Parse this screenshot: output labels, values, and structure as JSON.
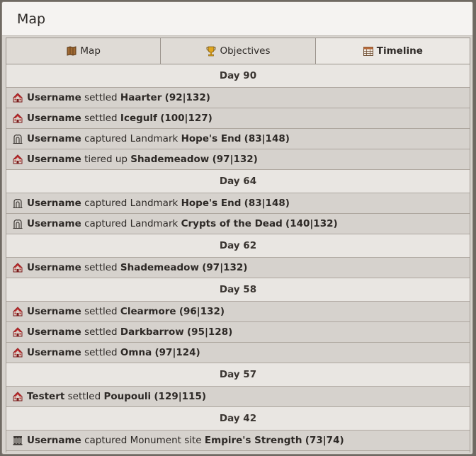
{
  "window": {
    "title": "Map"
  },
  "tabs": [
    {
      "label": "Map",
      "icon": "scroll-map-icon"
    },
    {
      "label": "Objectives",
      "icon": "trophy-icon"
    },
    {
      "label": "Timeline",
      "icon": "calendar-icon",
      "active": true
    }
  ],
  "timeline": [
    {
      "day": "Day 90",
      "events": [
        {
          "icon": "settlement-icon",
          "user": "Username",
          "action": "settled",
          "target": "Haarter",
          "coords": "(92|132)"
        },
        {
          "icon": "settlement-icon",
          "user": "Username",
          "action": "settled",
          "target": "Icegulf",
          "coords": "(100|127)"
        },
        {
          "icon": "landmark-icon",
          "user": "Username",
          "action": "captured Landmark",
          "target": "Hope's End",
          "coords": "(83|148)"
        },
        {
          "icon": "settlement-icon",
          "user": "Username",
          "action": "tiered up",
          "target": "Shademeadow",
          "coords": "(97|132)"
        }
      ]
    },
    {
      "day": "Day 64",
      "events": [
        {
          "icon": "landmark-icon",
          "user": "Username",
          "action": "captured Landmark",
          "target": "Hope's End",
          "coords": "(83|148)"
        },
        {
          "icon": "landmark-icon",
          "user": "Username",
          "action": "captured Landmark",
          "target": "Crypts of the Dead",
          "coords": "(140|132)"
        }
      ]
    },
    {
      "day": "Day 62",
      "events": [
        {
          "icon": "settlement-icon",
          "user": "Username",
          "action": "settled",
          "target": "Shademeadow",
          "coords": "(97|132)"
        }
      ]
    },
    {
      "day": "Day 58",
      "events": [
        {
          "icon": "settlement-icon",
          "user": "Username",
          "action": "settled",
          "target": "Clearmore",
          "coords": "(96|132)"
        },
        {
          "icon": "settlement-icon",
          "user": "Username",
          "action": "settled",
          "target": "Darkbarrow",
          "coords": "(95|128)"
        },
        {
          "icon": "settlement-icon",
          "user": "Username",
          "action": "settled",
          "target": "Omna",
          "coords": "(97|124)"
        }
      ]
    },
    {
      "day": "Day 57",
      "events": [
        {
          "icon": "settlement-icon",
          "user": "Testert",
          "action": "settled",
          "target": "Poupouli",
          "coords": "(129|115)"
        }
      ]
    },
    {
      "day": "Day 42",
      "events": [
        {
          "icon": "monument-icon",
          "user": "Username",
          "action": "captured Monument site",
          "target": "Empire's Strength",
          "coords": "(73|74)"
        }
      ]
    }
  ]
}
